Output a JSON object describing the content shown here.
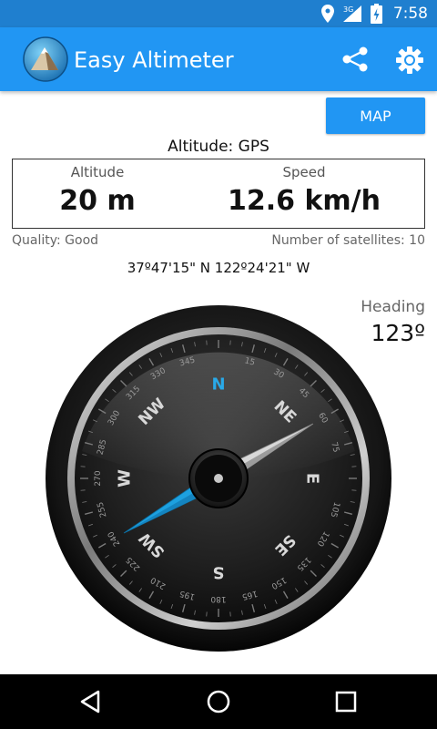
{
  "status_bar": {
    "time": "7:58",
    "network": "3G",
    "icons": [
      "location-icon",
      "signal-icon",
      "battery-charging-icon"
    ]
  },
  "app_bar": {
    "title": "Easy Altimeter",
    "logo_icon": "mountain-logo-icon",
    "actions": [
      "share-icon",
      "settings-gear-icon"
    ]
  },
  "map_button": {
    "label": "MAP"
  },
  "altitude_source": "Altitude: GPS",
  "readings": {
    "altitude_label": "Altitude",
    "altitude_value": "20 m",
    "speed_label": "Speed",
    "speed_value": "12.6 km/h"
  },
  "quality": "Quality: Good",
  "satellites": "Number of satellites: 10",
  "coordinates": "37º47'15\" N 122º24'21\" W",
  "heading": {
    "label": "Heading",
    "value": "123º",
    "degrees": 60
  },
  "compass": {
    "cardinals": [
      "N",
      "NE",
      "E",
      "SE",
      "S",
      "SW",
      "W",
      "NW"
    ],
    "degree_ticks": [
      "15",
      "30",
      "45",
      "60",
      "75",
      "105",
      "120",
      "135",
      "150",
      "165",
      "180",
      "195",
      "210",
      "225",
      "240",
      "255",
      "270",
      "285",
      "300",
      "315",
      "330",
      "345"
    ],
    "colors": {
      "cardinal_north": "#29a9e8",
      "needle_blue": "#1da1e0",
      "needle_silver": "#d8d8d8"
    }
  },
  "nav_bar": {
    "buttons": [
      "back-icon",
      "home-icon",
      "recents-icon"
    ]
  }
}
